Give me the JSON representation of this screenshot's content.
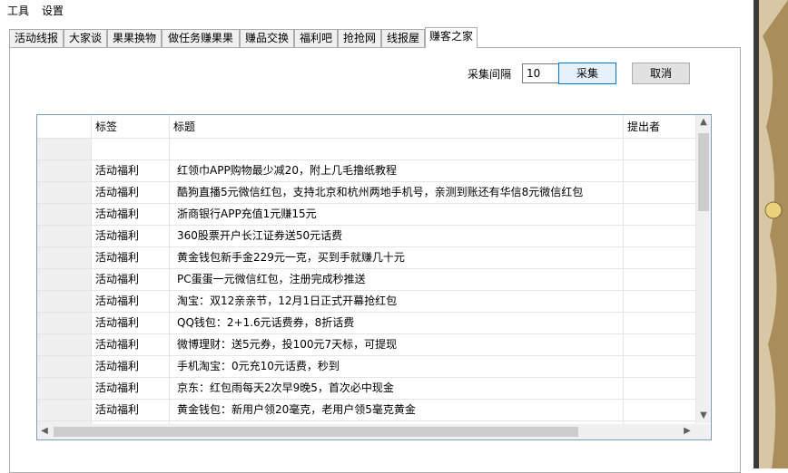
{
  "menubar": {
    "items": [
      "工具",
      "设置"
    ]
  },
  "tabs": [
    "活动线报",
    "大家谈",
    "果果换物",
    "做任务赚果果",
    "赚品交换",
    "福利吧",
    "抢抢网",
    "线报屋",
    "赚客之家"
  ],
  "active_tab": "赚客之家",
  "collector": {
    "interval_label": "采集间隔",
    "interval_value": "10",
    "collect_button": "采集",
    "cancel_button": "取消"
  },
  "grid": {
    "columns": [
      "标签",
      "标题",
      "提出者"
    ],
    "rows": [
      {
        "tag": "",
        "title": "",
        "author": ""
      },
      {
        "tag": "活动福利",
        "title": "红领巾APP购物最少减20，附上几毛撸纸教程",
        "author": ""
      },
      {
        "tag": "活动福利",
        "title": "酷狗直播5元微信红包，支持北京和杭州两地手机号，亲测到账还有华信8元微信红包",
        "author": ""
      },
      {
        "tag": "活动福利",
        "title": "浙商银行APP充值1元赚15元",
        "author": ""
      },
      {
        "tag": "活动福利",
        "title": "360股票开户长江证券送50元话费",
        "author": ""
      },
      {
        "tag": "活动福利",
        "title": "黄金钱包新手金229元一克，买到手就赚几十元",
        "author": ""
      },
      {
        "tag": "活动福利",
        "title": "PC蛋蛋一元微信红包，注册完成秒推送",
        "author": ""
      },
      {
        "tag": "活动福利",
        "title": "淘宝：双12亲亲节，12月1日正式开幕抢红包",
        "author": ""
      },
      {
        "tag": "活动福利",
        "title": "QQ钱包：2+1.6元话费券，8折话费",
        "author": ""
      },
      {
        "tag": "活动福利",
        "title": "微博理财：送5元券，投100元7天标，可提现",
        "author": ""
      },
      {
        "tag": "活动福利",
        "title": "手机淘宝：0元充10元话费，秒到",
        "author": ""
      },
      {
        "tag": "活动福利",
        "title": "京东：红包雨每天2次早9晚5，首次必中现金",
        "author": ""
      },
      {
        "tag": "活动福利",
        "title": "黄金钱包：新用户领20毫克，老用户领5毫克黄金",
        "author": ""
      },
      {
        "tag": "",
        "title": "",
        "author": ""
      }
    ]
  },
  "icons": {
    "scroll_up": "chevron-up-icon",
    "scroll_down": "chevron-down-icon",
    "scroll_left": "chevron-left-icon",
    "scroll_right": "chevron-right-icon"
  },
  "colors": {
    "tab_border": "#acacac",
    "grid_border": "#7f9db9",
    "primary_button_border": "#0078d7",
    "primary_button_bg": "#e5f1fb"
  }
}
